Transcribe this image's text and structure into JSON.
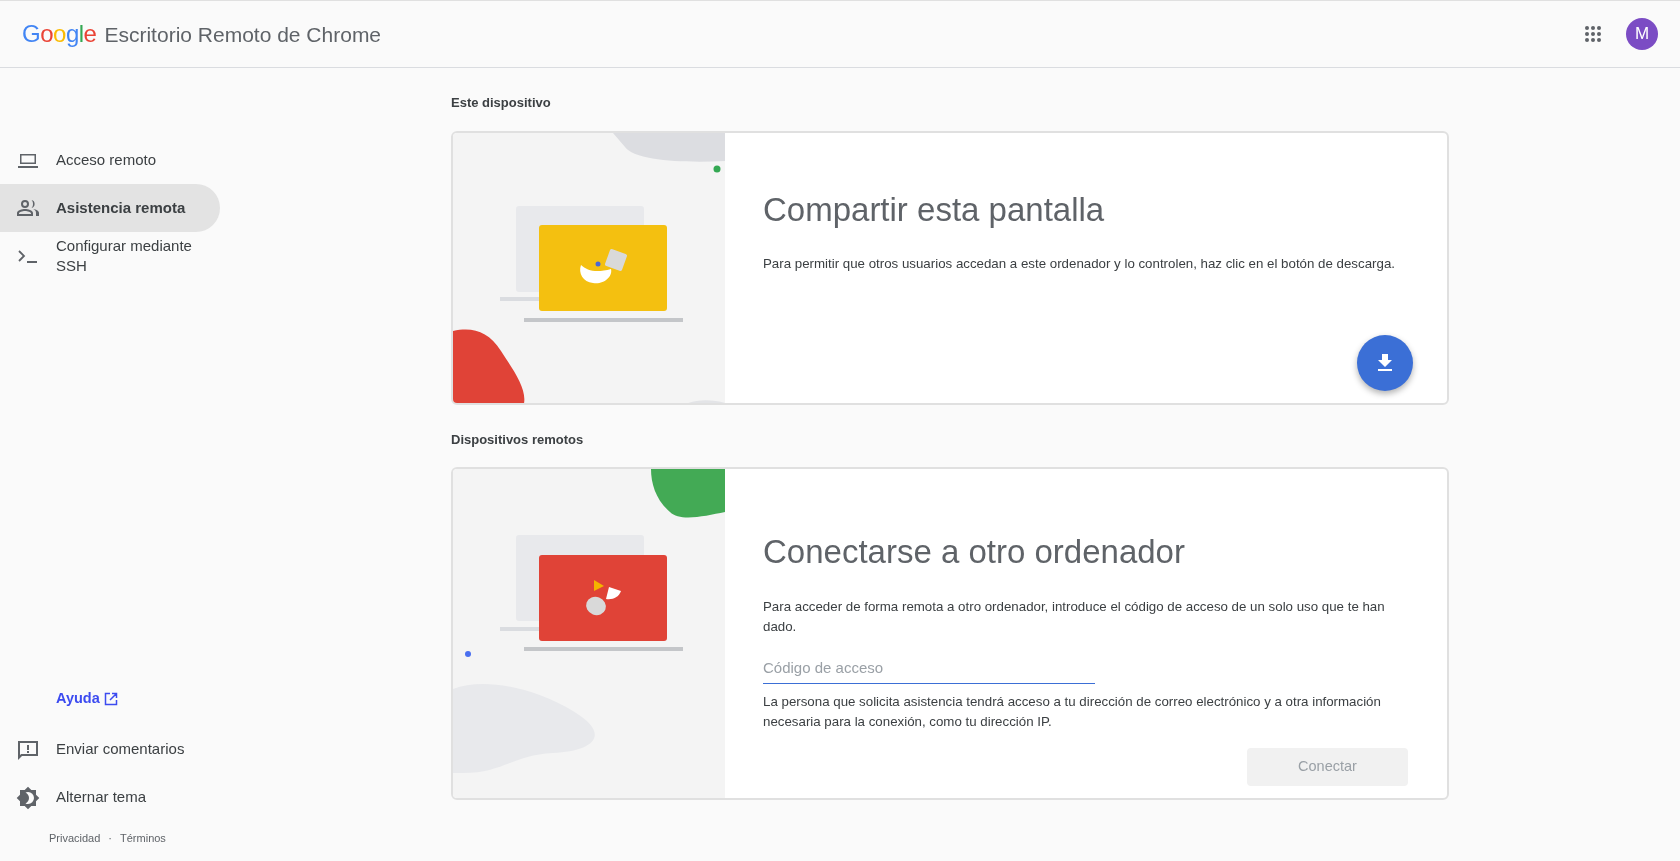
{
  "header": {
    "logo": "Google",
    "title": "Escritorio Remoto de Chrome",
    "avatar": "M"
  },
  "sidebar": {
    "items": [
      {
        "label": "Acceso remoto",
        "kind": "laptop",
        "selected": false
      },
      {
        "label": "Asistencia remota",
        "kind": "people",
        "selected": true
      },
      {
        "label": "Configurar mediante SSH",
        "kind": "terminal",
        "selected": false
      }
    ],
    "help": "Ayuda",
    "bottom_items": [
      {
        "label": "Enviar comentarios",
        "kind": "feedback"
      },
      {
        "label": "Alternar tema",
        "kind": "theme"
      }
    ],
    "footer": {
      "privacy": "Privacidad",
      "separator": "·",
      "terms": "Términos"
    }
  },
  "sections": [
    {
      "kind": "share",
      "heading": "Este dispositivo",
      "title": "Compartir esta pantalla",
      "description": "Para permitir que otros usuarios accedan a este ordenador y lo controlen, haz clic en el botón de descarga."
    },
    {
      "kind": "connect",
      "heading": "Dispositivos remotos",
      "title": "Conectarse a otro ordenador",
      "description": "Para acceder de forma remota a otro ordenador, introduce el código de acceso de un solo uso que te han dado.",
      "input": {
        "placeholder": "Código de acceso"
      },
      "note": "La persona que solicita asistencia tendrá acceso a tu dirección de correo electrónico y a otra información necesaria para la conexión, como tu dirección IP.",
      "button": {
        "label": "Conectar",
        "disabled": true
      }
    }
  ]
}
